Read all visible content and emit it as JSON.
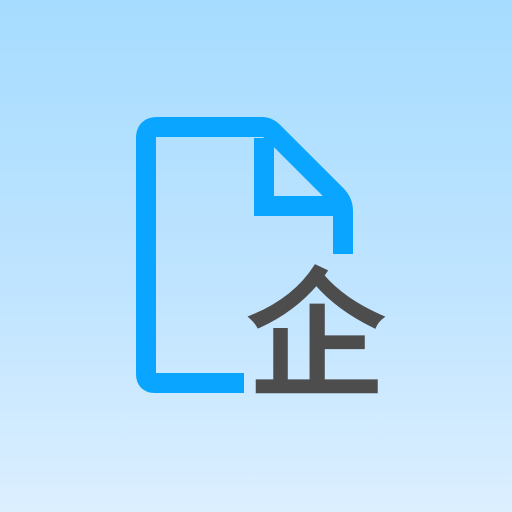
{
  "icon": {
    "name": "document-enterprise-icon",
    "badge_text": "企",
    "colors": {
      "background_top": "#a6dcff",
      "background_bottom": "#dcefff",
      "document_stroke": "#0aa5ff",
      "badge_text": "#4d4d4d"
    }
  }
}
